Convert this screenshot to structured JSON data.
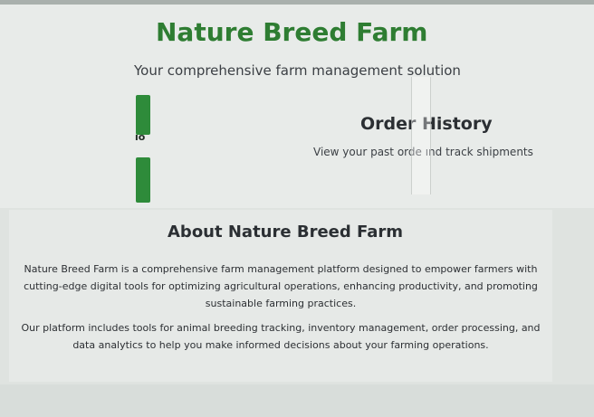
{
  "header": {
    "title": "Nature Breed Farm",
    "tagline": "Your comprehensive farm management solution"
  },
  "cards": {
    "left_fragment": "ıo",
    "order_history": {
      "title": "Order History",
      "description": "View your past orde    ınd track shipments"
    }
  },
  "about": {
    "title": "About Nature Breed Farm",
    "paragraph1": "Nature Breed Farm is a comprehensive farm management platform designed to empower farmers with cutting-edge digital tools for optimizing agricultural operations, enhancing productivity, and promoting sustainable farming practices.",
    "paragraph2": "Our platform includes tools for animal breeding tracking, inventory management, order processing, and data analytics to help you make informed decisions about your farming operations."
  },
  "colors": {
    "brand": "#2e7d32",
    "accent": "#2e8b3a",
    "background": "#dfe3e0"
  }
}
